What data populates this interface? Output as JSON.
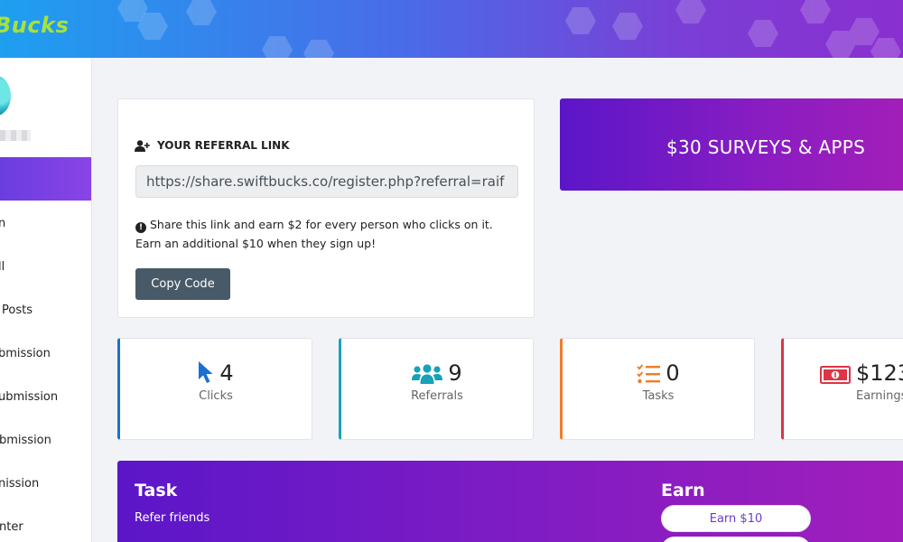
{
  "header": {
    "logo_text": "Bucks"
  },
  "sidebar": {
    "items": [
      {
        "label": "n"
      },
      {
        "label": "ll"
      },
      {
        "label": "Posts"
      },
      {
        "label": "bmission"
      },
      {
        "label": "ubmission"
      },
      {
        "label": "bmission"
      },
      {
        "label": "nission"
      },
      {
        "label": "nter"
      }
    ]
  },
  "referral": {
    "title": "YOUR REFERRAL LINK",
    "link": "https://share.swiftbucks.co/register.php?referral=raif",
    "note_line1": "Share this link and earn $2 for every person who clicks on it.",
    "note_line2": "Earn an additional $10 when they sign up!",
    "copy_label": "Copy Code"
  },
  "surveys": {
    "label": "$30 SURVEYS & APPS"
  },
  "stats": [
    {
      "value": "4",
      "label": "Clicks",
      "icon": "cursor-icon",
      "color": "#1b6fd1"
    },
    {
      "value": "9",
      "label": "Referrals",
      "icon": "users-icon",
      "color": "#17a2b8"
    },
    {
      "value": "0",
      "label": "Tasks",
      "icon": "tasks-icon",
      "color": "#f07d2a"
    },
    {
      "value": "$123",
      "label": "Earnings",
      "icon": "money-icon",
      "color": "#dc3545"
    }
  ],
  "task": {
    "title": "Task",
    "subtitle": "Refer friends",
    "earn_title": "Earn",
    "earn_button": "Earn $10"
  }
}
